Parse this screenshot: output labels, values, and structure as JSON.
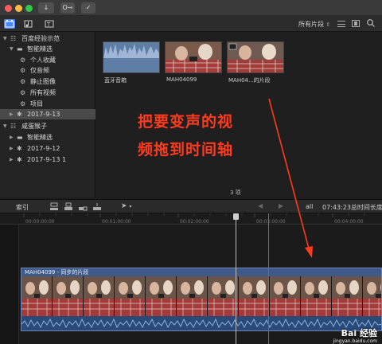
{
  "colors": {
    "accent": "#4a88ff",
    "annotation": "#ff3b1f",
    "clip_blue": "#3d5a8a"
  },
  "toolbar": {
    "import_icon": "download-icon",
    "key_label": "O⊸",
    "check_icon": "checkmark-icon",
    "filter_label": "所有片段",
    "filter_arrow": "⇕"
  },
  "sidebar": {
    "library": "百度经验示范",
    "smart_folder": "智能精选",
    "items": [
      "个人收藏",
      "仅音频",
      "静止图像",
      "所有视频",
      "项目"
    ],
    "event_selected": "2017-9-13",
    "library2": "咸蛋猴子",
    "smart_folder2": "智能精选",
    "events2": [
      "2017-9-12",
      "2017-9-13 1"
    ]
  },
  "browser": {
    "clips": [
      {
        "label": "蓝牙音箱"
      },
      {
        "label": "MAH04099"
      },
      {
        "label": "MAH04...的片段"
      }
    ],
    "count": "3 项"
  },
  "annotation": {
    "line1": "把要变声的视",
    "line2": "频拖到时间轴"
  },
  "timeline": {
    "index_label": "索引",
    "zoom_label": "all",
    "duration": "07:43:23总时间长度",
    "ticks": [
      "00:00:00:00",
      "00:01:00:00",
      "00:02:00:00",
      "00:03:00:00",
      "00:04:00:00"
    ],
    "clip_title": "MAH04099 - 同步的片段"
  },
  "watermark": {
    "text": "Bai 经验",
    "url": "jingyan.baidu.com"
  }
}
